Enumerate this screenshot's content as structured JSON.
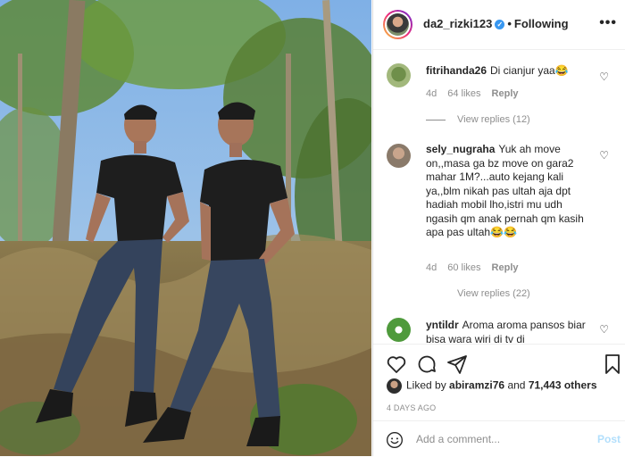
{
  "header": {
    "username": "da2_rizki123",
    "separator": "•",
    "follow_status": "Following",
    "more_icon": "more-horizontal-icon"
  },
  "comments": [
    {
      "username": "fitrihanda26",
      "text": "Di cianjur yaa😂",
      "age": "4d",
      "likes": "64 likes",
      "reply": "Reply",
      "view_replies": "View replies (12)"
    },
    {
      "username": "sely_nugraha",
      "text": "Yuk ah move on,,masa ga bz move on gara2 mahar 1M?...auto kejang kali ya,,blm nikah pas ultah aja dpt hadiah mobil lho,istri mu udh ngasih qm anak pernah qm kasih apa pas ultah😂😂",
      "age": "4d",
      "likes": "60 likes",
      "reply": "Reply",
      "view_replies": "View replies (22)"
    },
    {
      "username": "yntildr",
      "text": "Aroma aroma pansos biar bisa wara wiri di tv di"
    }
  ],
  "actions": {
    "like_icon": "heart-icon",
    "comment_icon": "comment-icon",
    "share_icon": "paper-plane-icon",
    "save_icon": "bookmark-icon"
  },
  "likes": {
    "prefix": "Liked by",
    "user": "abiramzi76",
    "middle": "and",
    "count": "71,443 others"
  },
  "time_ago": "4 DAYS AGO",
  "comment_box": {
    "emoji_icon": "smiley-icon",
    "placeholder": "Add a comment...",
    "post_label": "Post"
  },
  "colors": {
    "link_blue": "#3897f0",
    "post_disabled": "#b2dffc",
    "muted": "#8e8e8e"
  }
}
